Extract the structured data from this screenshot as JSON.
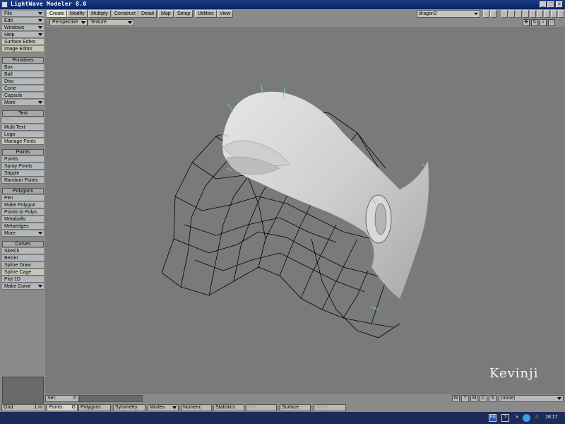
{
  "window": {
    "title": "LightWave Modeler 8.0",
    "controls": [
      "_",
      "□",
      "×"
    ]
  },
  "tabs": [
    "Create",
    "Modify",
    "Multiply",
    "Construct",
    "Detail",
    "Map",
    "Setup",
    "Utilities",
    "View"
  ],
  "active_tab": "Create",
  "object_selector": {
    "value": "dragon2"
  },
  "toolbar": {
    "menus": [
      {
        "label": "File"
      },
      {
        "label": "Edit"
      },
      {
        "label": "Windows"
      },
      {
        "label": "Help"
      }
    ],
    "editors": [
      "Surface Editor",
      "Image Editor"
    ],
    "sections": [
      {
        "title": "Primitives",
        "items": [
          "Box",
          "Ball",
          "Disc",
          "Cone",
          "Capsule",
          "More"
        ]
      },
      {
        "title": "Text",
        "items": [
          "Text",
          "Multi Text",
          "Logo",
          "Manage Fonts"
        ]
      },
      {
        "title": "Points",
        "items": [
          "Points",
          "Spray Points",
          "Stipple",
          "Random Points"
        ]
      },
      {
        "title": "Polygons",
        "items": [
          "Pen",
          "Make Polygon",
          "Points to Polys",
          "Metaballs",
          "Metaedges",
          "More"
        ]
      },
      {
        "title": "Curves",
        "items": [
          "Sketch",
          "Bezier",
          "Spline Draw",
          "Spline Cage",
          "Plot 1D",
          "Make Curve"
        ]
      }
    ]
  },
  "viewport": {
    "view_type": "Perspective",
    "render_mode": "Texture",
    "watermark": "Kevinji"
  },
  "status": {
    "sel_label": "Sel:",
    "sel_value": "0",
    "wtmcs": [
      "W",
      "T",
      "M",
      "C",
      "S"
    ],
    "surface_dropdown": "(none)",
    "grid_label": "Grid:",
    "grid_value": "1 m",
    "modes": [
      "Points",
      "Polygons",
      "Symmetry",
      "Modes",
      "Numeric",
      "Statistics",
      "Info",
      "Surface",
      "Make"
    ],
    "points_hint": "G"
  },
  "taskbar": {
    "lang": "EN",
    "clock": "18:17"
  },
  "colors": {
    "title_bar": "#0a2463",
    "toolbar_item": "#b4b8ba",
    "viewport_bg": "#7a7a7a",
    "mesh_surface": "#d8d8d8",
    "wireframe": "#000000",
    "highlight": "#66ccdd"
  }
}
